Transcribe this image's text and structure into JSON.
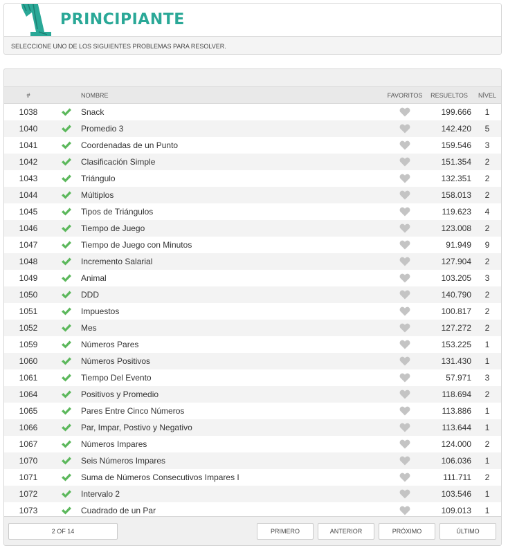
{
  "header": {
    "title": "PRINCIPIANTE",
    "subtitle": "SELECCIONE UNO DE LOS SIGUIENTES PROBLEMAS PARA RESOLVER.",
    "logo_color": "#2aa897"
  },
  "table": {
    "columns": {
      "num": "#",
      "name": "NOMBRE",
      "favorites": "FAVORITOS",
      "solved": "RESUELTOS",
      "level": "NÍVEL"
    },
    "check_color": "#5cb85c",
    "heart_color": "#c4c4c4",
    "rows": [
      {
        "id": "1038",
        "name": "Snack",
        "solved": "199.666",
        "level": "1"
      },
      {
        "id": "1040",
        "name": "Promedio 3",
        "solved": "142.420",
        "level": "5"
      },
      {
        "id": "1041",
        "name": "Coordenadas de un Punto",
        "solved": "159.546",
        "level": "3"
      },
      {
        "id": "1042",
        "name": "Clasificación Simple",
        "solved": "151.354",
        "level": "2"
      },
      {
        "id": "1043",
        "name": "Triángulo",
        "solved": "132.351",
        "level": "2"
      },
      {
        "id": "1044",
        "name": "Múltiplos",
        "solved": "158.013",
        "level": "2"
      },
      {
        "id": "1045",
        "name": "Tipos de Triángulos",
        "solved": "119.623",
        "level": "4"
      },
      {
        "id": "1046",
        "name": "Tiempo de Juego",
        "solved": "123.008",
        "level": "2"
      },
      {
        "id": "1047",
        "name": "Tiempo de Juego con Minutos",
        "solved": "91.949",
        "level": "9"
      },
      {
        "id": "1048",
        "name": "Incremento Salarial",
        "solved": "127.904",
        "level": "2"
      },
      {
        "id": "1049",
        "name": "Animal",
        "solved": "103.205",
        "level": "3"
      },
      {
        "id": "1050",
        "name": "DDD",
        "solved": "140.790",
        "level": "2"
      },
      {
        "id": "1051",
        "name": "Impuestos",
        "solved": "100.817",
        "level": "2"
      },
      {
        "id": "1052",
        "name": "Mes",
        "solved": "127.272",
        "level": "2"
      },
      {
        "id": "1059",
        "name": "Números Pares",
        "solved": "153.225",
        "level": "1"
      },
      {
        "id": "1060",
        "name": "Números Positivos",
        "solved": "131.430",
        "level": "1"
      },
      {
        "id": "1061",
        "name": "Tiempo Del Evento",
        "solved": "57.971",
        "level": "3"
      },
      {
        "id": "1064",
        "name": "Positivos y Promedio",
        "solved": "118.694",
        "level": "2"
      },
      {
        "id": "1065",
        "name": "Pares Entre Cinco Números",
        "solved": "113.886",
        "level": "1"
      },
      {
        "id": "1066",
        "name": "Par, Impar, Postivo y Negativo",
        "solved": "113.644",
        "level": "1"
      },
      {
        "id": "1067",
        "name": "Números Impares",
        "solved": "124.000",
        "level": "2"
      },
      {
        "id": "1070",
        "name": "Seis Números Impares",
        "solved": "106.036",
        "level": "1"
      },
      {
        "id": "1071",
        "name": "Suma de Números Consecutivos Impares I",
        "solved": "111.711",
        "level": "2"
      },
      {
        "id": "1072",
        "name": "Intervalo 2",
        "solved": "103.546",
        "level": "1"
      },
      {
        "id": "1073",
        "name": "Cuadrado de un Par",
        "solved": "109.013",
        "level": "1"
      }
    ]
  },
  "pagination": {
    "indicator": "2 OF 14",
    "first": "PRIMERO",
    "previous": "ANTERIOR",
    "next": "PRÓXIMO",
    "last": "ÚLTIMO"
  }
}
